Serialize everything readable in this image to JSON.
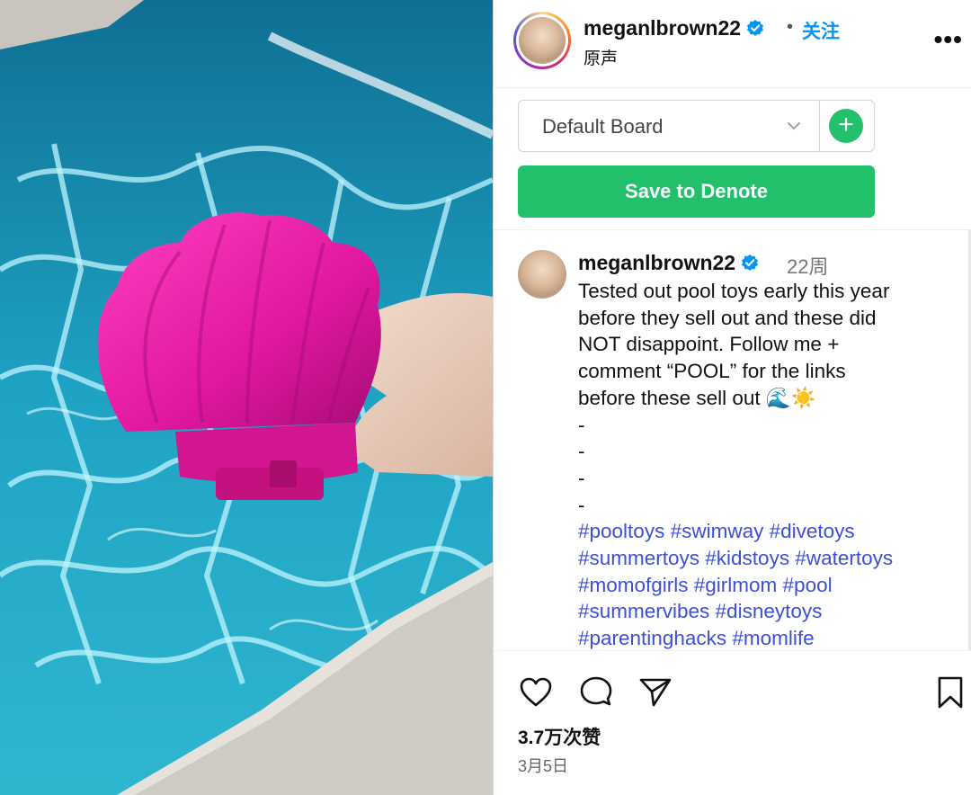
{
  "post": {
    "username": "meganlbrown22",
    "follow_label": "关注",
    "separator": "•",
    "audio_label": "原声",
    "more_label": "•••"
  },
  "board_picker": {
    "selected": "Default Board",
    "add_label": "+",
    "save_label": "Save to Denote"
  },
  "comment": {
    "username": "meganlbrown22",
    "time": "22周",
    "lines": [
      "Tested out pool toys early this year",
      "before they sell out and these did",
      "NOT disappoint. Follow me +",
      "comment “POOL” for the links",
      "before these sell out 🌊☀️",
      "-",
      "-",
      "-",
      "-"
    ],
    "hashtag_lines": [
      "#pooltoys #swimway #divetoys",
      "#summertoys #kidstoys #watertoys",
      "#momofgirls #girlmom #pool",
      "#summervibes #disneytoys",
      "#parentinghacks #momlife"
    ]
  },
  "stats": {
    "likes": "3.7万次赞",
    "date": "3月5日"
  },
  "colors": {
    "accent_blue": "#0095f6",
    "hashtag": "#3b4fd8",
    "save_green": "#22c06a"
  },
  "icons": [
    "verified-badge-icon",
    "more-icon",
    "chevron-down-icon",
    "plus-icon",
    "heart-icon",
    "comment-icon",
    "share-icon",
    "bookmark-icon"
  ]
}
